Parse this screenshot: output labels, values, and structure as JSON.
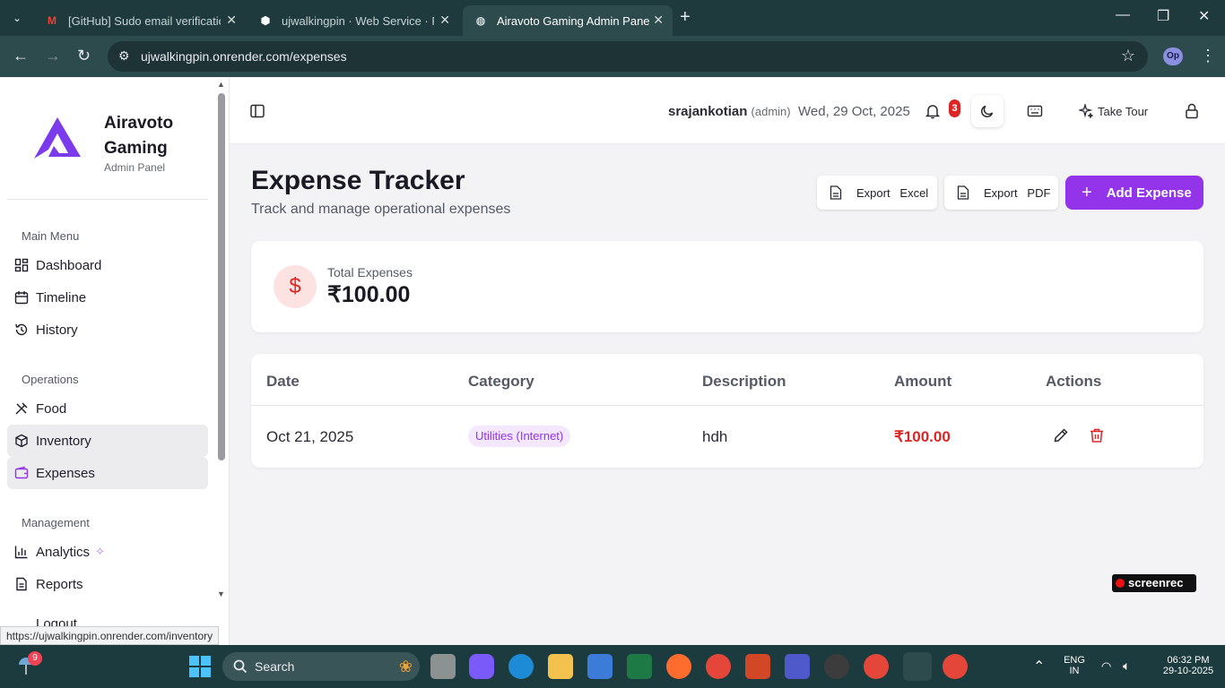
{
  "browser": {
    "tabs": [
      {
        "title": "[GitHub] Sudo email verification",
        "icon": "gmail-icon"
      },
      {
        "title": "ujwalkingpin · Web Service · Re",
        "icon": "render-icon"
      },
      {
        "title": "Airavoto Gaming Admin Panel",
        "icon": "globe-icon"
      }
    ],
    "url": "ujwalkingpin.onrender.com/expenses",
    "profile_initials": "Op"
  },
  "sidebar": {
    "brand_name": "Airavoto Gaming",
    "brand_sub": "Admin Panel",
    "sections": {
      "main": "Main Menu",
      "operations": "Operations",
      "management": "Management"
    },
    "items": {
      "dashboard": "Dashboard",
      "timeline": "Timeline",
      "history": "History",
      "food": "Food",
      "inventory": "Inventory",
      "expenses": "Expenses",
      "analytics": "Analytics",
      "reports": "Reports",
      "logout": "Logout"
    }
  },
  "header": {
    "username": "srajankotian",
    "role": "(admin)",
    "date": "Wed, 29 Oct, 2025",
    "notif_count": "3",
    "tour_label": "Take Tour"
  },
  "page": {
    "title": "Expense Tracker",
    "subtitle": "Track and manage operational expenses",
    "export_excel": "Export   Excel",
    "export_pdf": "Export   PDF",
    "add_expense": "Add Expense"
  },
  "summary": {
    "label": "Total Expenses",
    "value": "₹100.00"
  },
  "table": {
    "headers": [
      "Date",
      "Category",
      "Description",
      "Amount",
      "Actions"
    ],
    "rows": [
      {
        "date": "Oct 21, 2025",
        "category": "Utilities (Internet)",
        "description": "hdh",
        "amount": "₹100.00"
      }
    ]
  },
  "watermark": "screenrec",
  "status_link": "https://ujwalkingpin.onrender.com/inventory",
  "taskbar": {
    "search_label": "Search",
    "weather_badge": "9",
    "lang": "ENG",
    "region": "IN",
    "time": "06:32 PM",
    "date": "29-10-2025"
  },
  "colors": {
    "accent": "#9333ea",
    "danger": "#dc2626",
    "chrome": "#1f3a3d"
  }
}
